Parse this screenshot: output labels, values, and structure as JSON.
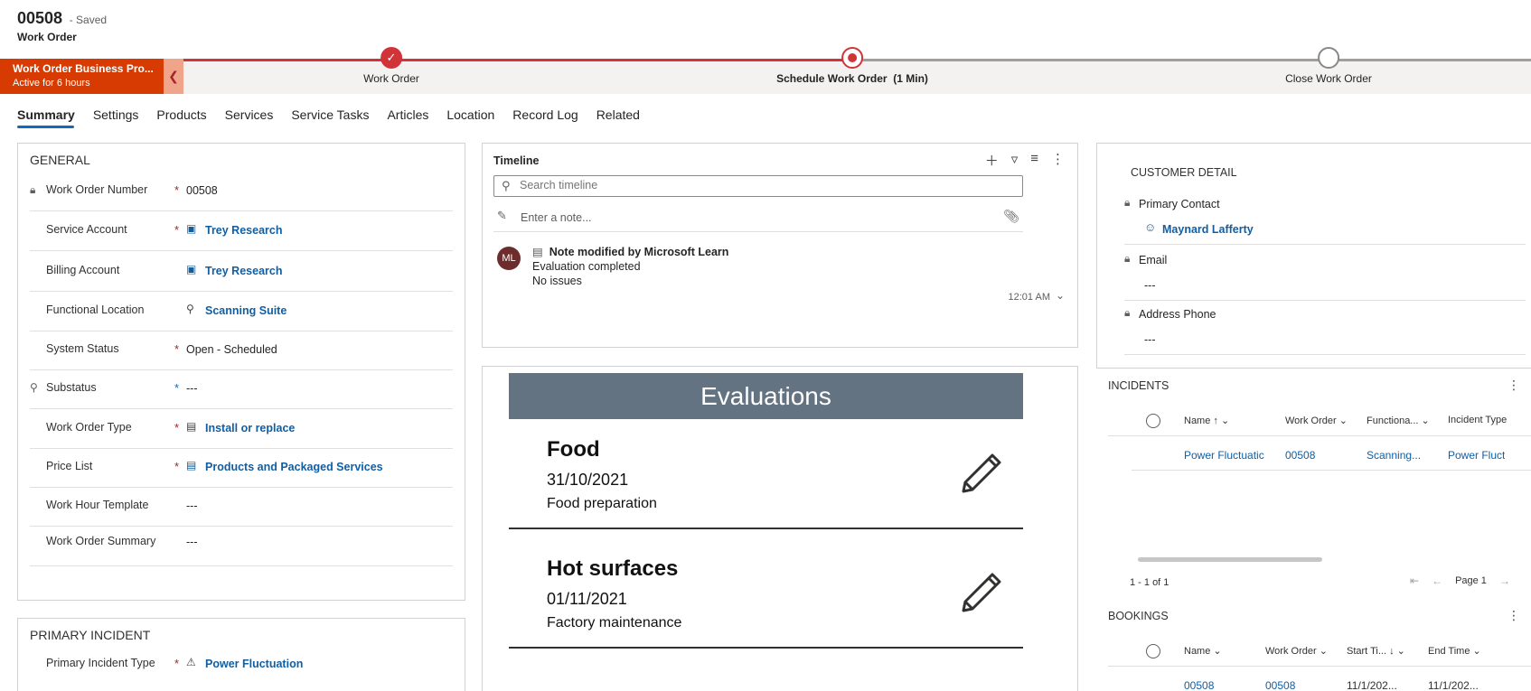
{
  "header": {
    "record_number": "00508",
    "save_state": "- Saved",
    "entity": "Work Order"
  },
  "bpf": {
    "flag_title": "Work Order Business Pro...",
    "flag_subtitle": "Active for 6 hours",
    "collapse_icon": "chevron-left-icon",
    "stages": [
      {
        "label": "Work Order",
        "state": "done"
      },
      {
        "label": "Schedule Work Order",
        "duration": "(1 Min)",
        "state": "active"
      },
      {
        "label": "Close Work Order",
        "state": "todo"
      }
    ],
    "accent": "#d13438"
  },
  "tabs": [
    "Summary",
    "Settings",
    "Products",
    "Services",
    "Service Tasks",
    "Articles",
    "Location",
    "Record Log",
    "Related"
  ],
  "general": {
    "title": "GENERAL",
    "fields": [
      {
        "label": "Work Order Number",
        "value": "00508",
        "required": "*"
      },
      {
        "label": "Service Account",
        "value": "Trey Research",
        "required": "*"
      },
      {
        "label": "Billing Account",
        "value": "Trey Research"
      },
      {
        "label": "Functional Location",
        "value": "Scanning Suite"
      },
      {
        "label": "System Status",
        "value": "Open - Scheduled",
        "required": "*"
      },
      {
        "label": "Substatus",
        "value": "---",
        "required": "*"
      },
      {
        "label": "Work Order Type",
        "value": "Install or replace",
        "required": "*"
      },
      {
        "label": "Price List",
        "value": "Products and Packaged Services",
        "required": "*"
      },
      {
        "label": "Work Hour Template",
        "value": "---"
      },
      {
        "label": "Work Order Summary",
        "value": "---"
      }
    ]
  },
  "primary_incident": {
    "title": "PRIMARY INCIDENT",
    "field_label": "Primary Incident Type",
    "required": "*",
    "value": "Power Fluctuation"
  },
  "timeline": {
    "title": "Timeline",
    "search_placeholder": "Search timeline",
    "note_placeholder": "Enter a note...",
    "entry": {
      "avatar": "ML",
      "heading": "Note modified by Microsoft Learn",
      "line1": "Evaluation completed",
      "line2": "No issues",
      "time": "12:01 AM"
    }
  },
  "evaluations": {
    "title": "Evaluations",
    "header_color": "#637381",
    "items": [
      {
        "name": "Food",
        "date": "31/10/2021",
        "description": "Food preparation"
      },
      {
        "name": "Hot surfaces",
        "date": "01/11/2021",
        "description": "Factory maintenance"
      }
    ]
  },
  "customer_detail": {
    "title": "CUSTOMER DETAIL",
    "fields": [
      {
        "label": "Primary Contact",
        "value": "Maynard Lafferty"
      },
      {
        "label": "Email",
        "value": "---"
      },
      {
        "label": "Address Phone",
        "value": "---"
      }
    ]
  },
  "incidents": {
    "title": "INCIDENTS",
    "columns": [
      "Name",
      "Work Order",
      "Functiona...",
      "Incident Type"
    ],
    "rows": [
      {
        "name": "Power Fluctuatic",
        "work_order": "00508",
        "functional": "Scanning...",
        "incident_type": "Power Fluct"
      }
    ],
    "count_text": "1 - 1 of 1",
    "page_text": "Page 1"
  },
  "bookings": {
    "title": "BOOKINGS",
    "columns": [
      "Name",
      "Work Order",
      "Start Ti...",
      "End Time"
    ],
    "rows": [
      {
        "name": "00508",
        "work_order": "00508",
        "start": "11/1/202...",
        "end": "11/1/202..."
      }
    ]
  }
}
